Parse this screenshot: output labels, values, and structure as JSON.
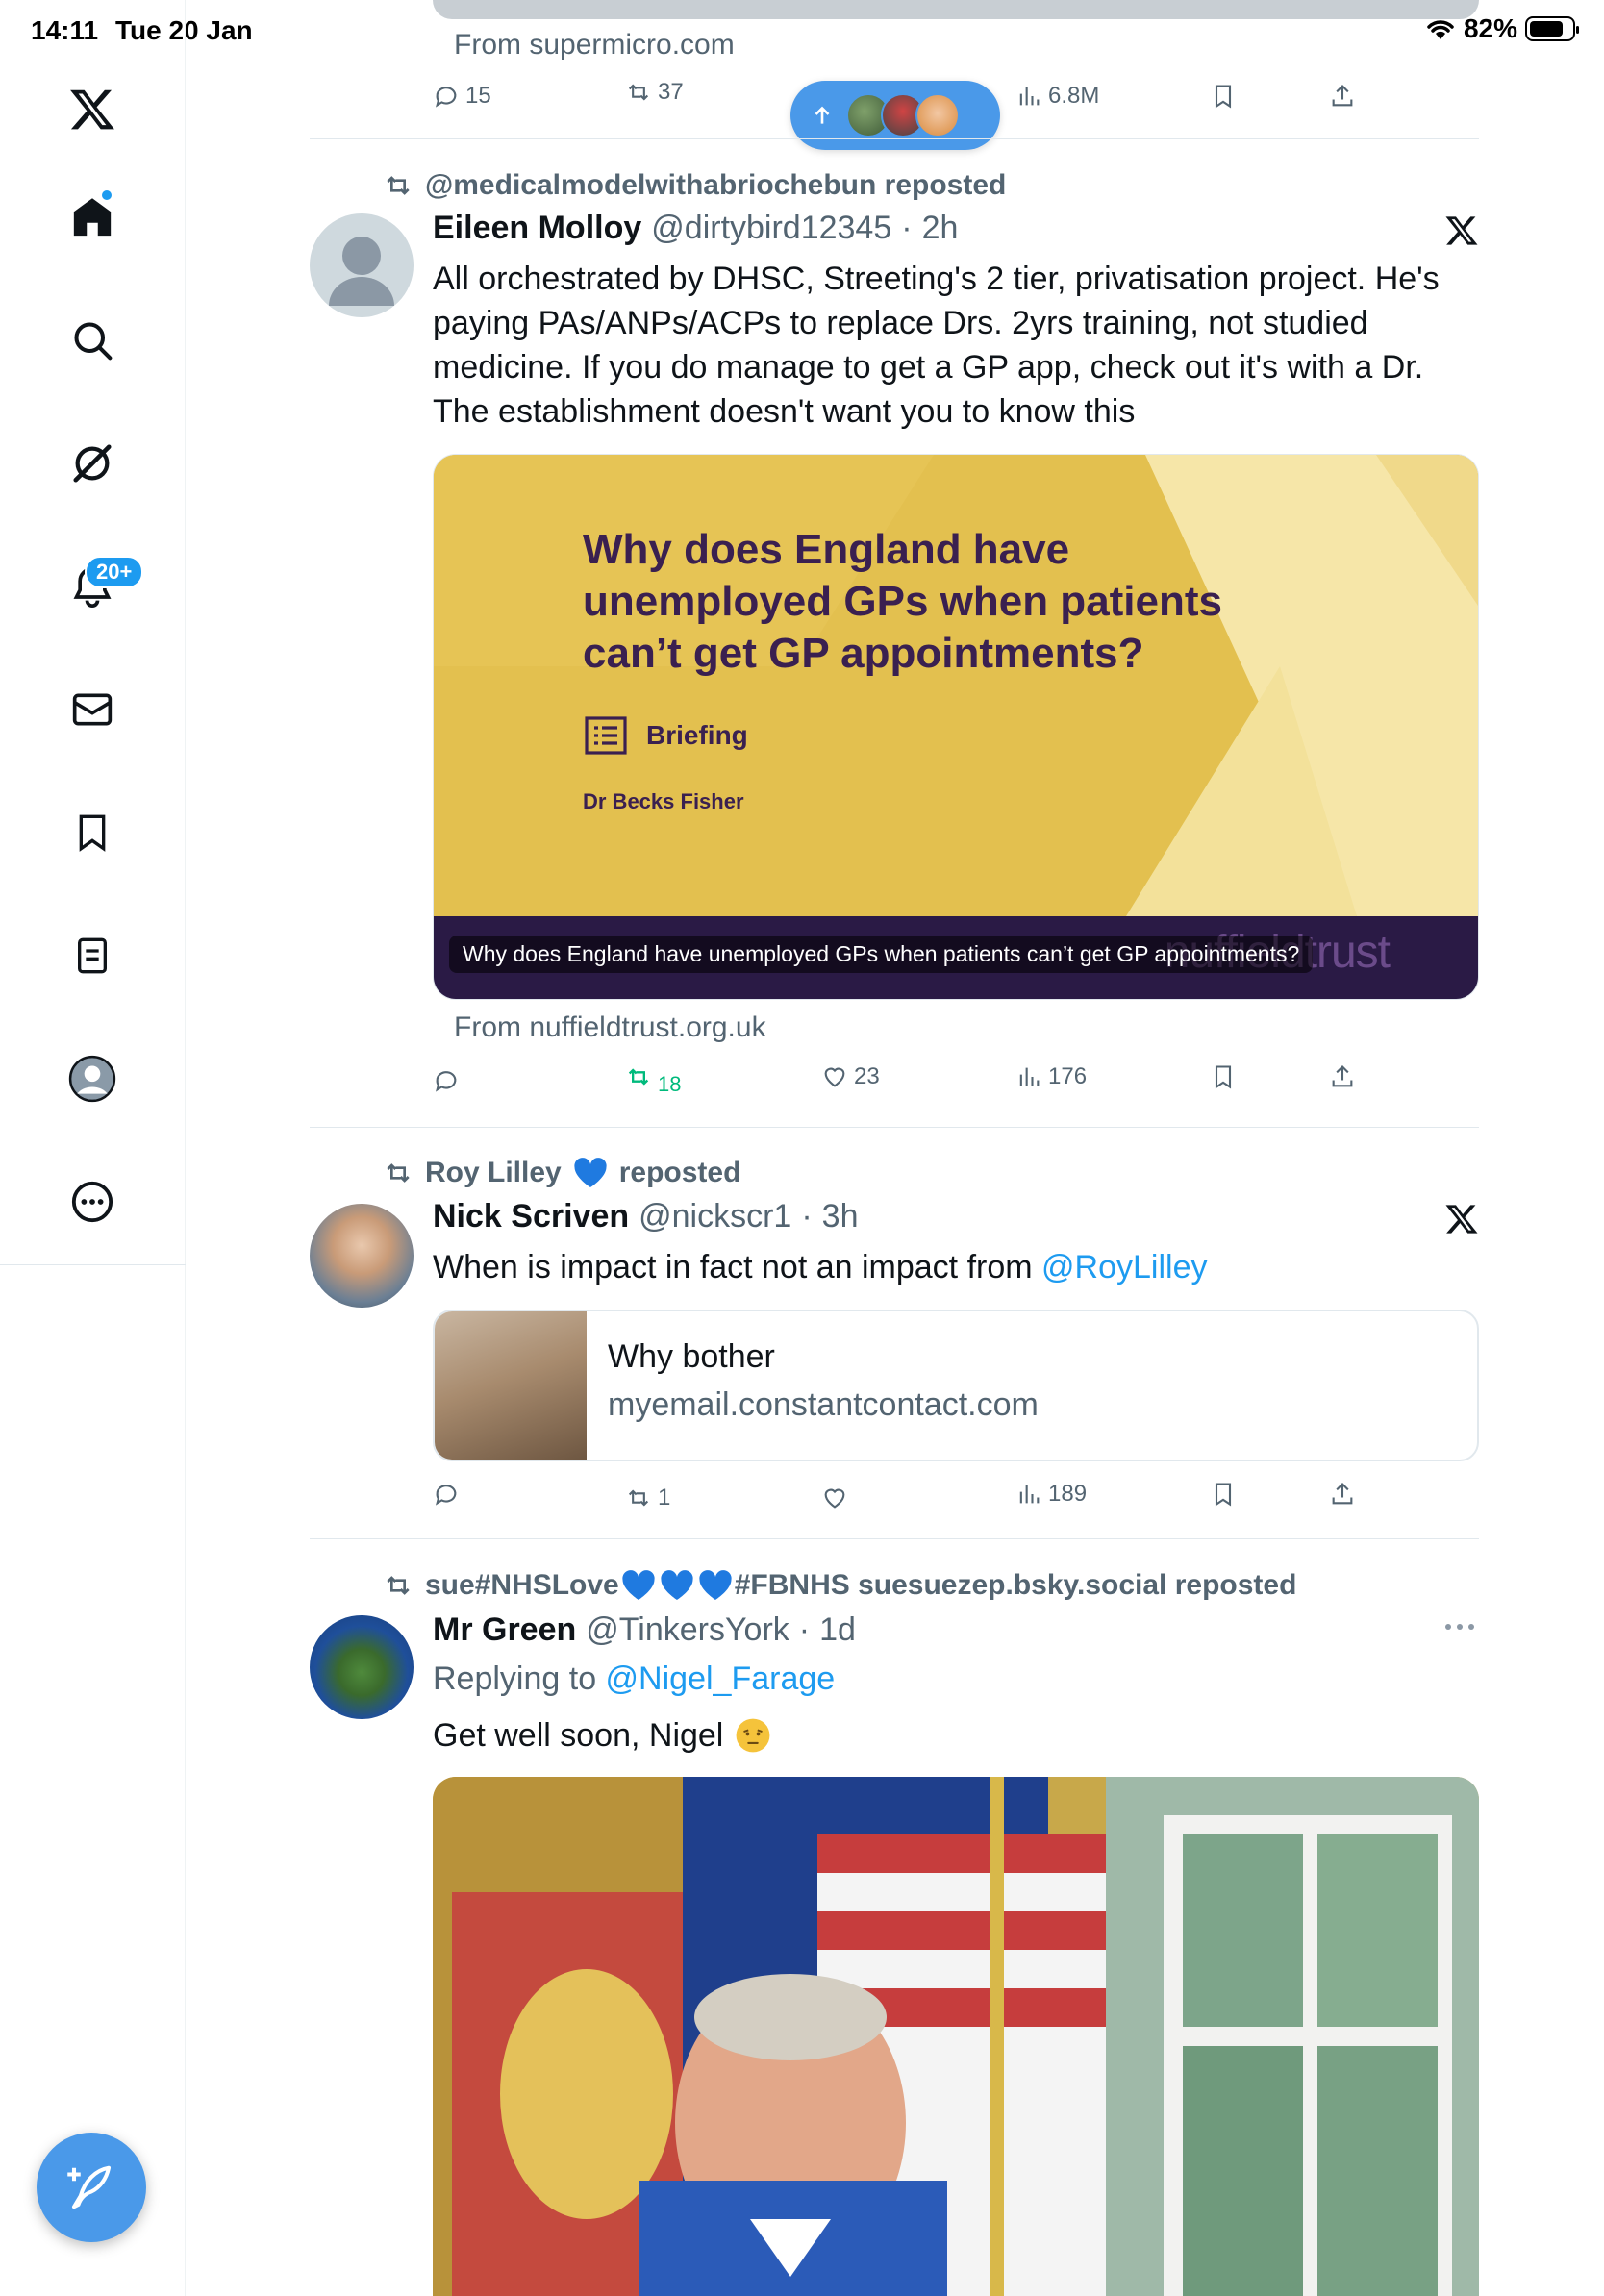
{
  "status_bar": {
    "time": "14:11",
    "date": "Tue 20 Jan",
    "battery": "82%"
  },
  "colors": {
    "accent": "#1d9bf0",
    "repost_green": "#00ba7c",
    "muted": "#536471"
  },
  "sidebar": {
    "items": [
      {
        "name": "x-logo-icon"
      },
      {
        "name": "home-icon"
      },
      {
        "name": "search-icon"
      },
      {
        "name": "grok-icon"
      },
      {
        "name": "notifications-icon",
        "badge": "20+"
      },
      {
        "name": "messages-icon"
      },
      {
        "name": "bookmarks-icon"
      },
      {
        "name": "lists-icon"
      },
      {
        "name": "profile-icon"
      },
      {
        "name": "more-icon"
      }
    ],
    "compose": "compose-icon"
  },
  "top_partial": {
    "from": "From supermicro.com",
    "replies": "15",
    "reposts": "37",
    "views": "6.8M"
  },
  "tweets": [
    {
      "repost_by": "@medicalmodelwithabriochebun reposted",
      "name": "Eileen Molloy",
      "handle": "@dirtybird12345",
      "sep": "·",
      "time": "2h",
      "text": "All orchestrated by DHSC, Streeting's 2 tier, privatisation project. He's paying PAs/ANPs/ACPs to replace Drs. 2yrs training, not studied medicine. If you do manage to get a GP app, check out it's with a Dr. The establishment doesn't want you to know this",
      "card": {
        "title": "Why does England have unemployed GPs when patients can’t get GP appointments?",
        "label": "Briefing",
        "author": "Dr Becks Fisher",
        "caption": "Why does England have unemployed GPs when patients can’t get GP appointments?",
        "logo": "nuffieldtrust",
        "from": "From nuffieldtrust.org.uk"
      },
      "reposts": "18",
      "likes": "23",
      "views": "176"
    },
    {
      "repost_by_name": "Roy Lilley",
      "repost_by_suffix": "reposted",
      "name": "Nick Scriven",
      "handle": "@nickscr1",
      "sep": "·",
      "time": "3h",
      "text_before": "When is impact in fact not an impact from ",
      "mention": "@RoyLilley",
      "card": {
        "title": "Why bother",
        "domain": "myemail.constantcontact.com"
      },
      "reposts": "1",
      "views": "189"
    },
    {
      "repost_by_start": "sue#NHSLove",
      "repost_by_end": "#FBNHS suesuezep.bsky.social reposted",
      "name": "Mr Green",
      "handle": "@TinkersYork",
      "sep": "·",
      "time": "1d",
      "replying_prefix": "Replying to ",
      "replying_to": "@Nigel_Farage",
      "text": "Get well soon, Nigel"
    }
  ]
}
